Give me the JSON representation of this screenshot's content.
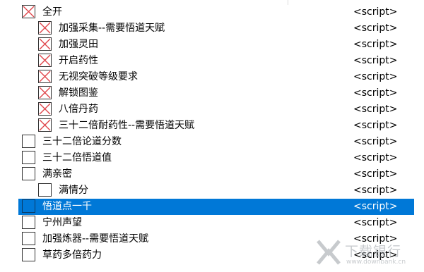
{
  "rows": [
    {
      "label": "全开",
      "value": "<script>",
      "checked": true,
      "indent": 0
    },
    {
      "label": "加强采集--需要悟道天赋",
      "value": "<script>",
      "checked": true,
      "indent": 1
    },
    {
      "label": "加强灵田",
      "value": "<script>",
      "checked": true,
      "indent": 1
    },
    {
      "label": "开启药性",
      "value": "<script>",
      "checked": true,
      "indent": 1
    },
    {
      "label": "无视突破等级要求",
      "value": "<script>",
      "checked": true,
      "indent": 1
    },
    {
      "label": "解锁图鉴",
      "value": "<script>",
      "checked": true,
      "indent": 1
    },
    {
      "label": "八倍丹药",
      "value": "<script>",
      "checked": true,
      "indent": 1
    },
    {
      "label": "三十二倍耐药性--需要悟道天赋",
      "value": "<script>",
      "checked": true,
      "indent": 1
    },
    {
      "label": "三十二倍论道分数",
      "value": "<script>",
      "checked": false,
      "indent": 0
    },
    {
      "label": "三十二倍悟道值",
      "value": "<script>",
      "checked": false,
      "indent": 0
    },
    {
      "label": "满亲密",
      "value": "<script>",
      "checked": false,
      "indent": 0
    },
    {
      "label": "满情分",
      "value": "<script>",
      "checked": false,
      "indent": 1
    },
    {
      "label": "悟道点一千",
      "value": "<script>",
      "checked": false,
      "indent": 0,
      "selected": true
    },
    {
      "label": "宁州声望",
      "value": "<script>",
      "checked": false,
      "indent": 0
    },
    {
      "label": "加强炼器--需要悟道天赋",
      "value": "<script>",
      "checked": false,
      "indent": 0
    },
    {
      "label": "草药多倍药力",
      "value": "<script>",
      "checked": false,
      "indent": 0
    }
  ],
  "watermark": {
    "brand": "下载银行",
    "url": "www.downbank.cn"
  },
  "colors": {
    "selection": "#0078d7",
    "check_mark": "#e0454a"
  }
}
